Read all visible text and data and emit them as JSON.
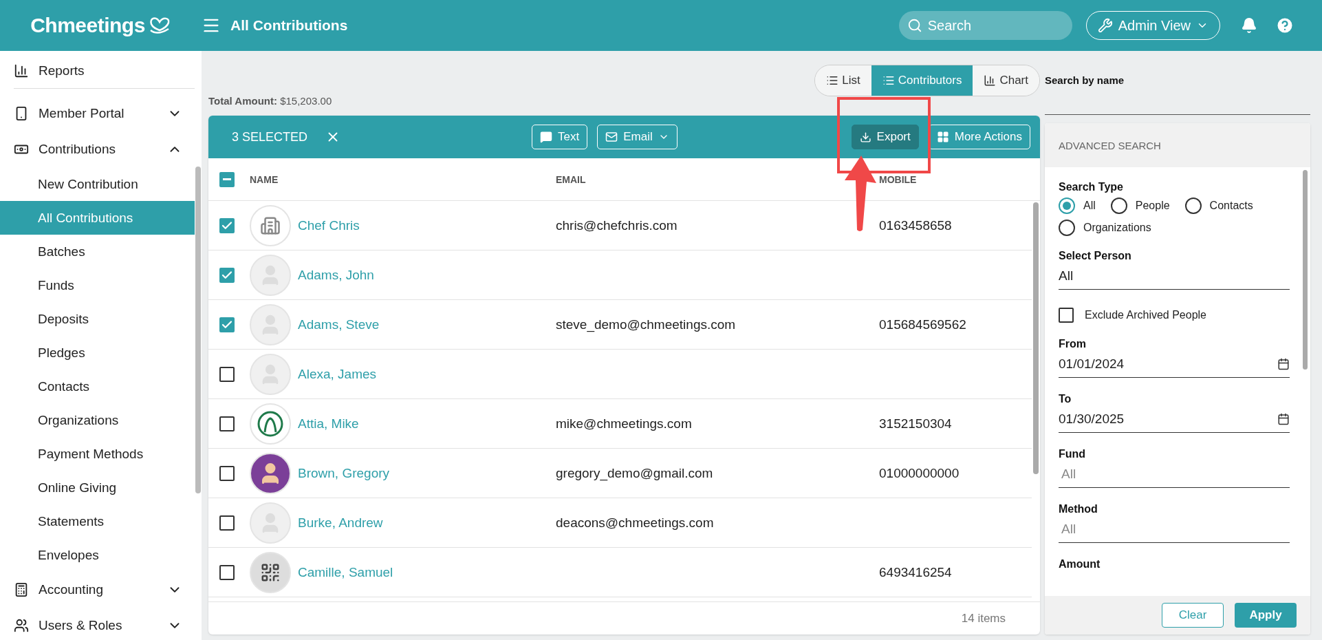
{
  "header": {
    "logo": "Chmeetings",
    "title": "All Contributions",
    "search": {
      "placeholder": "Search"
    },
    "admin_view": "Admin View"
  },
  "sidebar": {
    "items": [
      {
        "kind": "plain",
        "label": "Reports",
        "selected": false
      },
      {
        "kind": "group",
        "label": "Member Portal",
        "selected": false,
        "expanded": false
      },
      {
        "kind": "group",
        "label": "Contributions",
        "selected": false,
        "expanded": true,
        "children": [
          {
            "label": "New Contribution",
            "selected": false
          },
          {
            "label": "All Contributions",
            "selected": true
          },
          {
            "label": "Batches",
            "selected": false
          },
          {
            "label": "Funds",
            "selected": false
          },
          {
            "label": "Deposits",
            "selected": false
          },
          {
            "label": "Pledges",
            "selected": false
          },
          {
            "label": "Contacts",
            "selected": false
          },
          {
            "label": "Organizations",
            "selected": false
          },
          {
            "label": "Payment Methods",
            "selected": false
          },
          {
            "label": "Online Giving",
            "selected": false
          },
          {
            "label": "Statements",
            "selected": false
          },
          {
            "label": "Envelopes",
            "selected": false
          }
        ]
      },
      {
        "kind": "group",
        "label": "Accounting",
        "selected": false,
        "expanded": false
      },
      {
        "kind": "group",
        "label": "Users & Roles",
        "selected": false,
        "expanded": false
      }
    ]
  },
  "total": {
    "label": "Total Amount:",
    "value": "$15,203.00"
  },
  "view_tabs": [
    {
      "label": "List",
      "selected": false
    },
    {
      "label": "Contributors",
      "selected": true
    },
    {
      "label": "Chart",
      "selected": false
    }
  ],
  "selection_bar": {
    "count": "3 SELECTED",
    "text_button": "Text",
    "email_button": "Email",
    "export_button": "Export",
    "more_button": "More Actions"
  },
  "table": {
    "select_all_indeterminate": true,
    "columns": [
      "NAME",
      "EMAIL",
      "MOBILE"
    ],
    "rows": [
      {
        "checked": true,
        "kind": "building",
        "name": "Chef Chris",
        "email": "chris@chefchris.com",
        "mobile": "0163458658"
      },
      {
        "checked": true,
        "kind": "silhouette",
        "name": "Adams, John"
      },
      {
        "checked": true,
        "kind": "silhouette",
        "name": "Adams, Steve",
        "email": "steve_demo@chmeetings.com",
        "mobile": "015684569562"
      },
      {
        "checked": false,
        "kind": "silhouette",
        "name": "Alexa, James"
      },
      {
        "checked": false,
        "kind": "emblem",
        "name": "Attia, Mike",
        "email": "mike@chmeetings.com",
        "mobile": "3152150304"
      },
      {
        "checked": false,
        "kind": "cartoon",
        "name": "Brown, Gregory",
        "email": "gregory_demo@gmail.com",
        "mobile": "01000000000"
      },
      {
        "checked": false,
        "kind": "silhouette",
        "name": "Burke, Andrew",
        "email": "deacons@chmeetings.com"
      },
      {
        "checked": false,
        "kind": "qr",
        "name": "Camille, Samuel",
        "mobile": "6493416254"
      }
    ],
    "footer": "14 items"
  },
  "search_panel": {
    "label": "Search by name",
    "title": "ADVANCED SEARCH",
    "type_label": "Search Type",
    "types": [
      {
        "label": "All",
        "selected": true
      },
      {
        "label": "People",
        "selected": false
      },
      {
        "label": "Contacts",
        "selected": false
      },
      {
        "label": "Organizations",
        "selected": false
      }
    ],
    "fields": [
      {
        "kind": "select",
        "label": "Select Person",
        "value": "All"
      },
      {
        "kind": "checkbox",
        "label": "Exclude Archived People",
        "checked": false
      },
      {
        "kind": "date",
        "label": "From",
        "value": "01/01/2024"
      },
      {
        "kind": "date",
        "label": "To",
        "value": "01/30/2025"
      },
      {
        "kind": "select",
        "label": "Fund",
        "placeholder": "All"
      },
      {
        "kind": "select",
        "label": "Method",
        "placeholder": "All"
      },
      {
        "kind": "heading",
        "label": "Amount"
      }
    ],
    "clear_button": "Clear",
    "apply_button": "Apply"
  }
}
